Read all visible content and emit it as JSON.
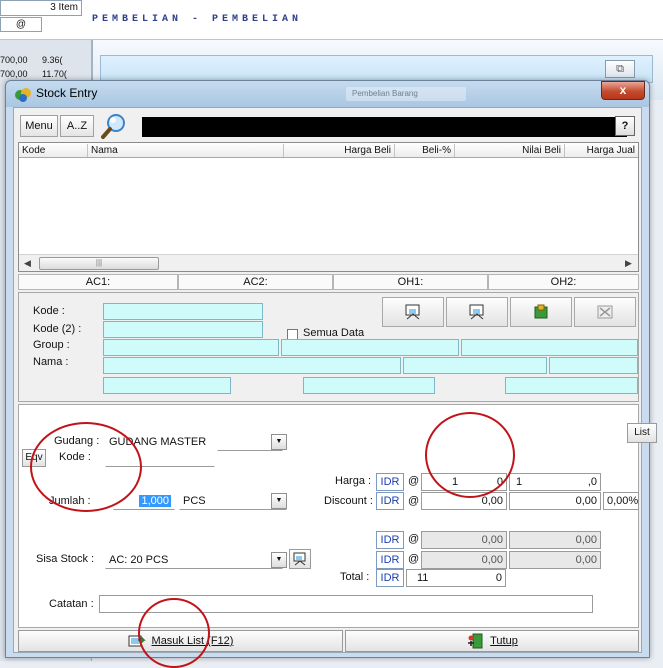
{
  "background_app": {
    "item_count": "3 Item",
    "col_symbol": "@",
    "row1_a": "700,00",
    "row1_b": "9.36(",
    "row2_a": "700,00",
    "row2_b": "11.70(",
    "module_title": "PEMBELIAN - PEMBELIAN"
  },
  "window": {
    "title": "Stock Entry",
    "close_label": "x",
    "inactive_caption": "Pembelian Barang"
  },
  "toolbar": {
    "menu_label": "Menu",
    "az_label": "A..Z",
    "help_label": "?"
  },
  "grid": {
    "columns": [
      "Kode",
      "Nama",
      "Harga Beli",
      "Beli-%",
      "Nilai Beli",
      "Harga Jual"
    ],
    "rows": []
  },
  "ac_strip": {
    "ac1": "AC1:",
    "ac2": "AC2:",
    "oh1": "OH1:",
    "oh2": "OH2:"
  },
  "search": {
    "kode_label": "Kode :",
    "kode2_label": "Kode (2) :",
    "group_label": "Group :",
    "nama_label": "Nama :",
    "semua_label": "Semua Data",
    "semua_checked": false
  },
  "entry": {
    "gudang_label": "Gudang :",
    "gudang_value": "GUDANG MASTER",
    "eqv_label": "Eqv",
    "kode_label": "Kode :",
    "kode_value": "",
    "jumlah_label": "Jumlah :",
    "jumlah_value": "1,000",
    "unit_value": "PCS",
    "list_label": "List",
    "harga_label": "Harga :",
    "discount_label": "Discount :",
    "currency": "IDR",
    "at_symbol": "@",
    "harga_qty": "1",
    "harga_price": "0",
    "harga_total_lead": "1",
    "harga_total": ",0",
    "discount_value": "0,00",
    "discount_amount": "0,00",
    "discount_pct": "0,00%",
    "sisa_label": "Sisa Stock :",
    "sisa_value": "AC: 20 PCS",
    "extra1_value": "0,00",
    "extra1_total": "0,00",
    "extra2_value": "0,00",
    "extra2_total": "0,00",
    "total_label": "Total :",
    "total_lead": "11",
    "total_value": "0",
    "catatan_label": "Catatan :",
    "catatan_value": ""
  },
  "buttons": {
    "masuk_list": "Masuk List (F12)",
    "tutup": "Tutup"
  },
  "colors": {
    "field_cyan": "#cffbfb",
    "annotation_red": "#c0141a",
    "titlebar": "#b7d0e8"
  }
}
